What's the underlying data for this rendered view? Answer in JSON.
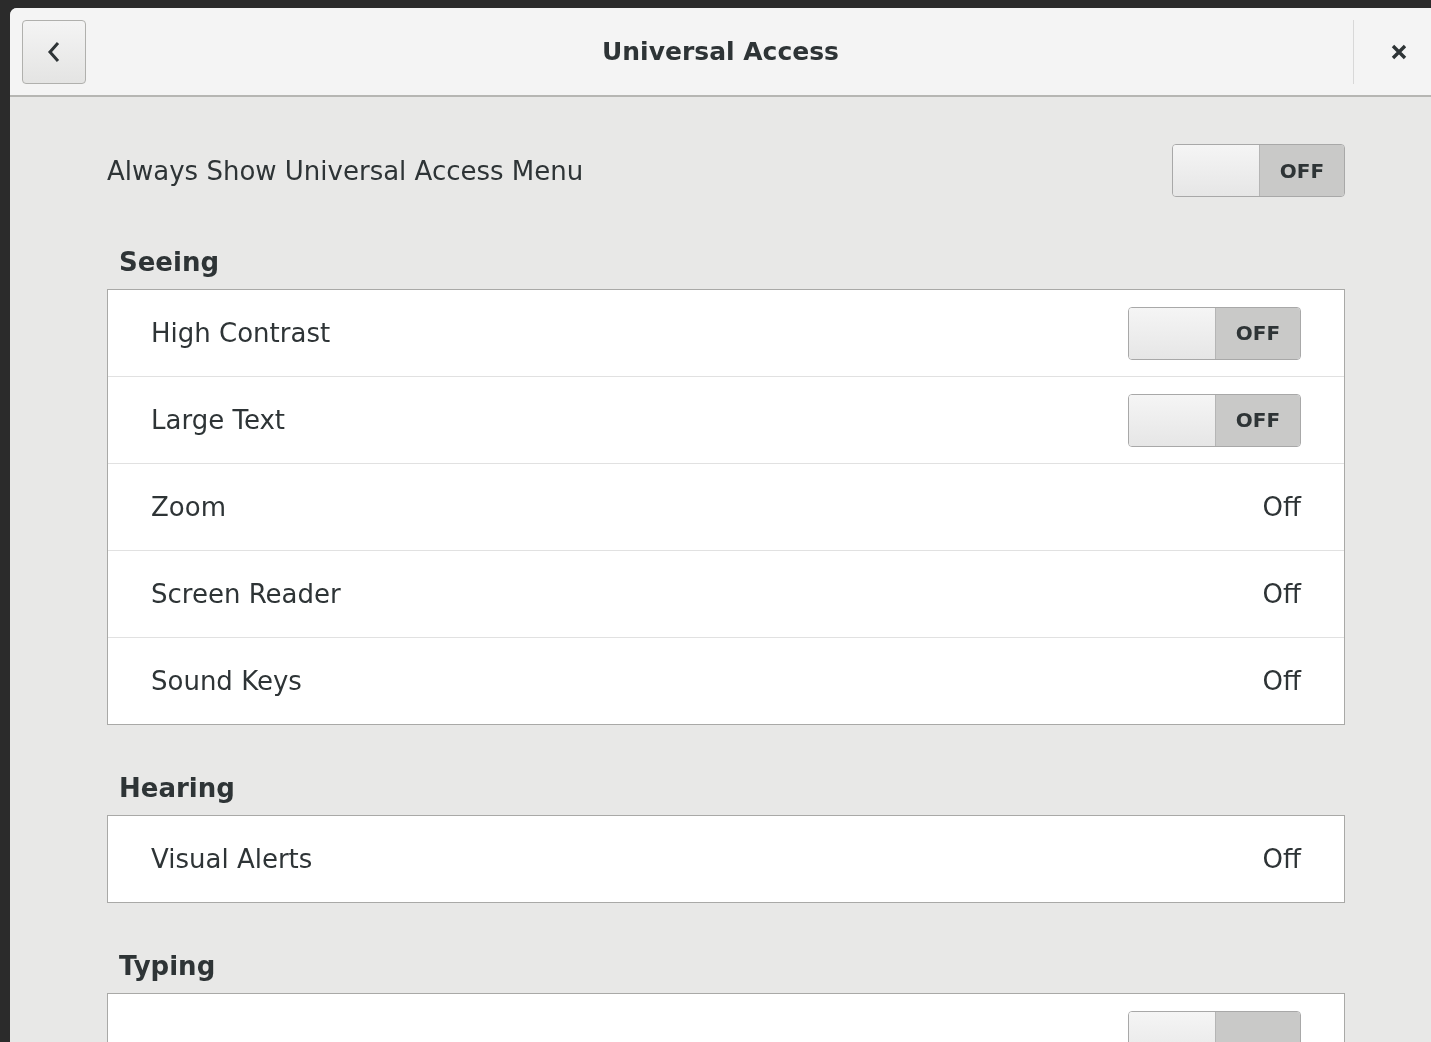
{
  "window": {
    "title": "Universal Access"
  },
  "top_setting": {
    "label": "Always Show Universal Access Menu",
    "on": false,
    "state_text": "OFF"
  },
  "sections": [
    {
      "heading": "Seeing",
      "rows": [
        {
          "kind": "switch",
          "label": "High Contrast",
          "on": false,
          "state_text": "OFF"
        },
        {
          "kind": "switch",
          "label": "Large Text",
          "on": false,
          "state_text": "OFF"
        },
        {
          "kind": "value",
          "label": "Zoom",
          "value": "Off"
        },
        {
          "kind": "value",
          "label": "Screen Reader",
          "value": "Off"
        },
        {
          "kind": "value",
          "label": "Sound Keys",
          "value": "Off"
        }
      ]
    },
    {
      "heading": "Hearing",
      "rows": [
        {
          "kind": "value",
          "label": "Visual Alerts",
          "value": "Off"
        }
      ]
    },
    {
      "heading": "Typing",
      "rows": [
        {
          "kind": "switch",
          "on": false
        }
      ]
    }
  ]
}
